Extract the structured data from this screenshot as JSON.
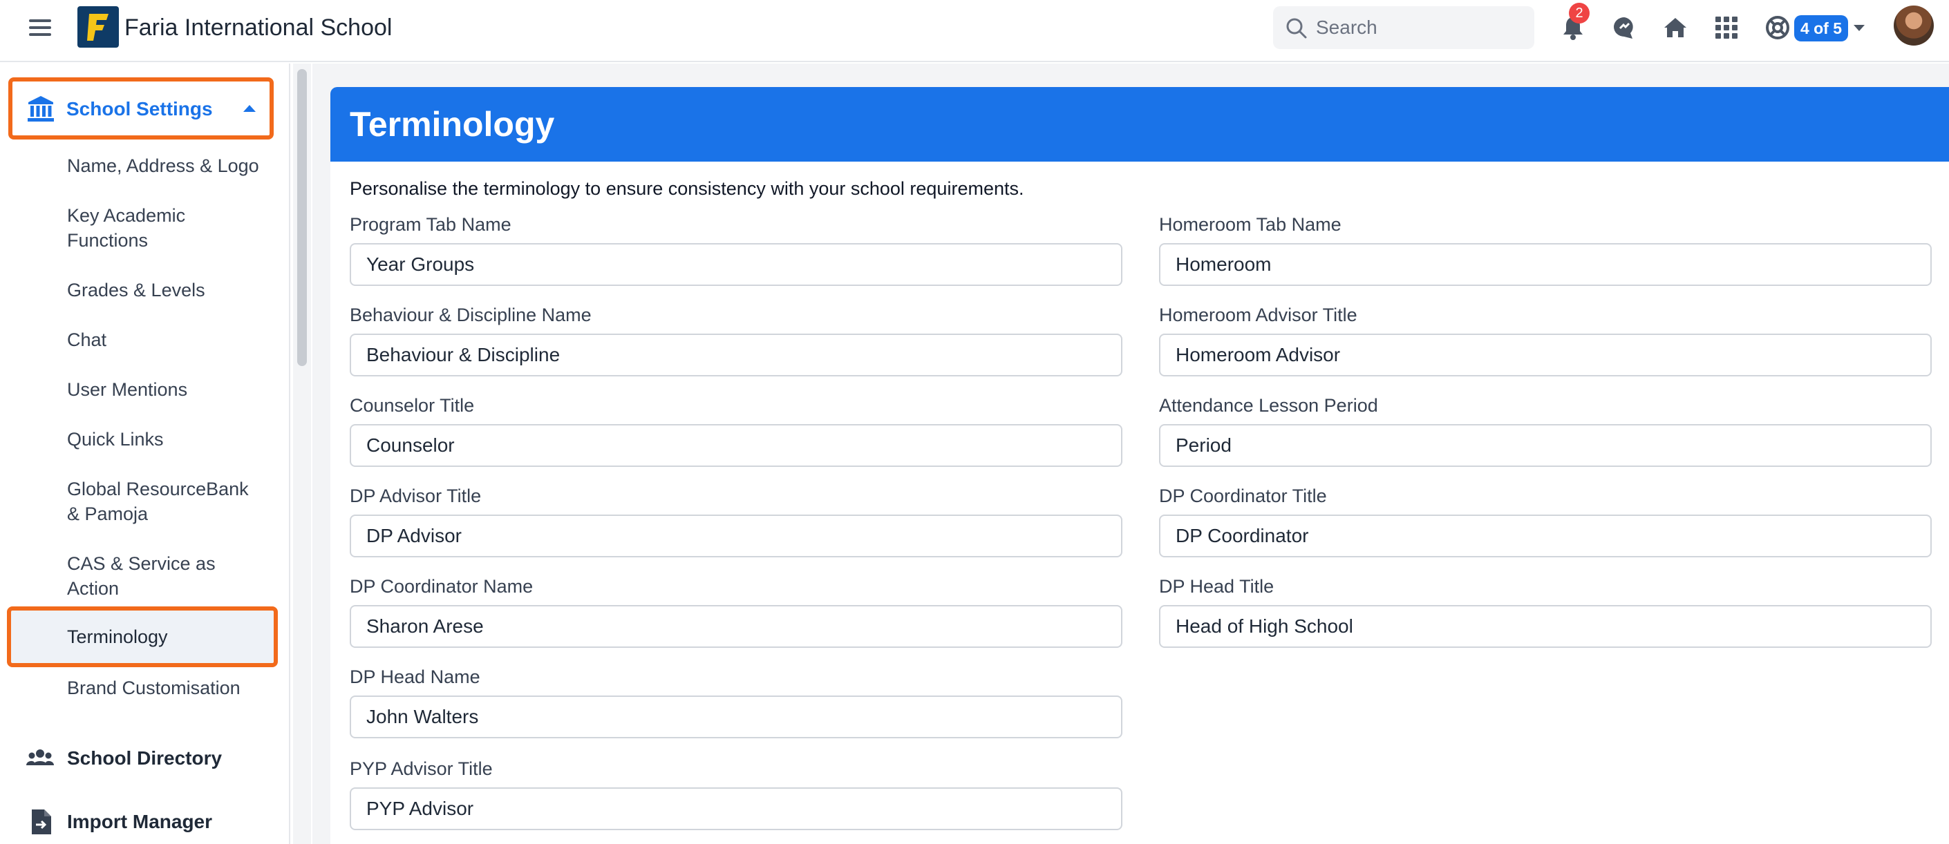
{
  "app": {
    "school_name": "Faria International School",
    "logo_letter": "F"
  },
  "topbar": {
    "search_placeholder": "Search",
    "notification_count": "2",
    "pagination_pill": "4 of 5",
    "icons": [
      "menu-icon",
      "search-icon",
      "bell-icon",
      "chat-icon",
      "home-icon",
      "apps-grid-icon",
      "help-lifebuoy-icon"
    ]
  },
  "sidebar": {
    "section_title": "School Settings",
    "items": [
      {
        "label": "Name, Address & Logo"
      },
      {
        "label": "Key Academic Functions"
      },
      {
        "label": "Grades & Levels"
      },
      {
        "label": "Chat"
      },
      {
        "label": "User Mentions"
      },
      {
        "label": "Quick Links"
      },
      {
        "label": "Global ResourceBank & Pamoja"
      },
      {
        "label": "CAS & Service as Action"
      },
      {
        "label": "Terminology"
      },
      {
        "label": "Brand Customisation"
      }
    ],
    "sections": [
      {
        "label": "School Directory"
      },
      {
        "label": "Import Manager"
      }
    ]
  },
  "page": {
    "title": "Terminology",
    "intro": "Personalise the terminology to ensure consistency with your school requirements."
  },
  "form": {
    "left": [
      {
        "label": "Program Tab Name",
        "value": "Year Groups"
      },
      {
        "label": "Behaviour & Discipline Name",
        "value": "Behaviour & Discipline"
      },
      {
        "label": "Counselor Title",
        "value": "Counselor"
      },
      {
        "label": "DP Advisor Title",
        "value": "DP Advisor"
      },
      {
        "label": "DP Coordinator Name",
        "value": "Sharon Arese"
      },
      {
        "label": "DP Head Name",
        "value": "John Walters"
      },
      {
        "label": "PYP Advisor Title",
        "value": "PYP Advisor"
      }
    ],
    "right": [
      {
        "label": "Homeroom Tab Name",
        "value": "Homeroom"
      },
      {
        "label": "Homeroom Advisor Title",
        "value": "Homeroom Advisor"
      },
      {
        "label": "Attendance Lesson Period",
        "value": "Period"
      },
      {
        "label": "DP Coordinator Title",
        "value": "DP Coordinator"
      },
      {
        "label": "DP Head Title",
        "value": "Head of High School"
      }
    ]
  },
  "colors": {
    "accent": "#1a73e8",
    "highlight": "#f26a1b",
    "badge": "#ef4444"
  }
}
